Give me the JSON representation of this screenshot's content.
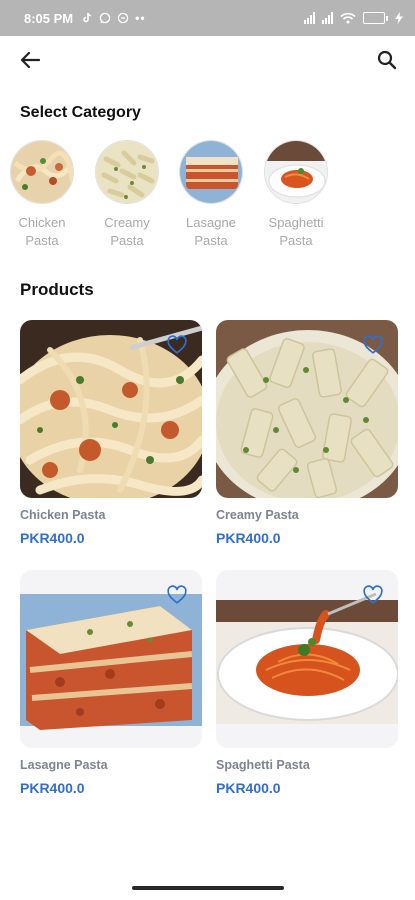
{
  "status_bar": {
    "time": "8:05 PM",
    "battery_percent": 75,
    "icons_left": [
      "tiktok-icon",
      "whatsapp-icon",
      "circle-icon",
      "more-icon"
    ],
    "icons_right": [
      "signal-icon",
      "signal-icon",
      "wifi-icon",
      "battery-icon",
      "bolt-icon"
    ]
  },
  "app_bar": {
    "back_icon": "arrow-left-icon",
    "search_icon": "search-icon"
  },
  "categories": {
    "title": "Select Category",
    "items": [
      {
        "label_line1": "Chicken",
        "label_line2": "Pasta"
      },
      {
        "label_line1": "Creamy",
        "label_line2": "Pasta"
      },
      {
        "label_line1": "Lasagne",
        "label_line2": "Pasta"
      },
      {
        "label_line1": "Spaghetti",
        "label_line2": "Pasta"
      }
    ]
  },
  "products": {
    "title": "Products",
    "items": [
      {
        "name": "Chicken Pasta",
        "price": "PKR400.0"
      },
      {
        "name": "Creamy Pasta",
        "price": "PKR400.0"
      },
      {
        "name": "Lasagne Pasta",
        "price": "PKR400.0"
      },
      {
        "name": "Spaghetti Pasta",
        "price": "PKR400.0"
      }
    ]
  },
  "colors": {
    "status_bar_bg": "#b5b5b5",
    "price": "#2f6fd1",
    "product_name": "#7f8493",
    "category_label": "#a9a9a9",
    "heart_outline": "#2f6fd1"
  }
}
